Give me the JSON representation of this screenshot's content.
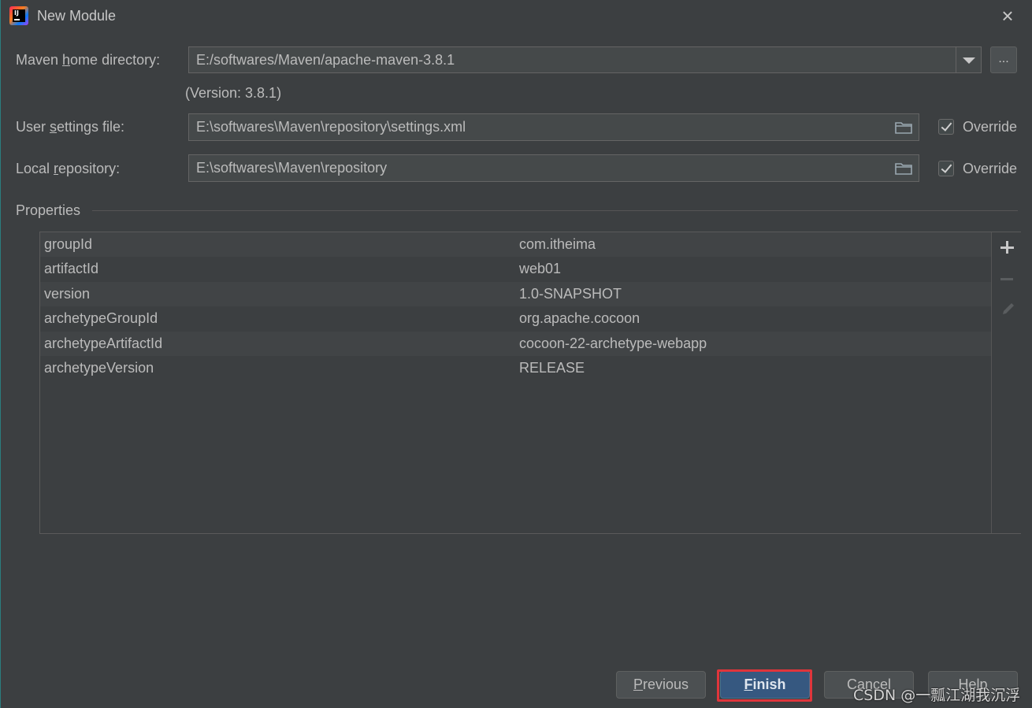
{
  "window": {
    "title": "New Module",
    "icon": "intellij-idea-icon",
    "icon_text": "IJ"
  },
  "maven_home": {
    "label_pre": "Maven ",
    "label_mnemonic": "h",
    "label_post": "ome directory:",
    "value": "E:/softwares/Maven/apache-maven-3.8.1",
    "ellipsis": "...",
    "version": "(Version: 3.8.1)"
  },
  "user_settings": {
    "label_pre": "User ",
    "label_mnemonic": "s",
    "label_post": "ettings file:",
    "value": "E:\\softwares\\Maven\\repository\\settings.xml",
    "override_label": "Override",
    "override_checked": true
  },
  "local_repo": {
    "label_pre": "Local ",
    "label_mnemonic": "r",
    "label_post": "epository:",
    "value": "E:\\softwares\\Maven\\repository",
    "override_label": "Override",
    "override_checked": true
  },
  "properties": {
    "label": "Properties",
    "rows": [
      {
        "key": "groupId",
        "value": "com.itheima"
      },
      {
        "key": "artifactId",
        "value": "web01"
      },
      {
        "key": "version",
        "value": "1.0-SNAPSHOT"
      },
      {
        "key": "archetypeGroupId",
        "value": "org.apache.cocoon"
      },
      {
        "key": "archetypeArtifactId",
        "value": "cocoon-22-archetype-webapp"
      },
      {
        "key": "archetypeVersion",
        "value": "RELEASE"
      }
    ]
  },
  "buttons": {
    "previous_mnemonic": "P",
    "previous_rest": "revious",
    "finish_mnemonic": "F",
    "finish_rest": "inish",
    "cancel": "Cancel",
    "help": "Help"
  },
  "watermark": "CSDN @一瓢江湖我沉浮",
  "colors": {
    "background": "#3c3f41",
    "field": "#45494a",
    "primary_button": "#365880",
    "highlight": "#e0353b"
  }
}
